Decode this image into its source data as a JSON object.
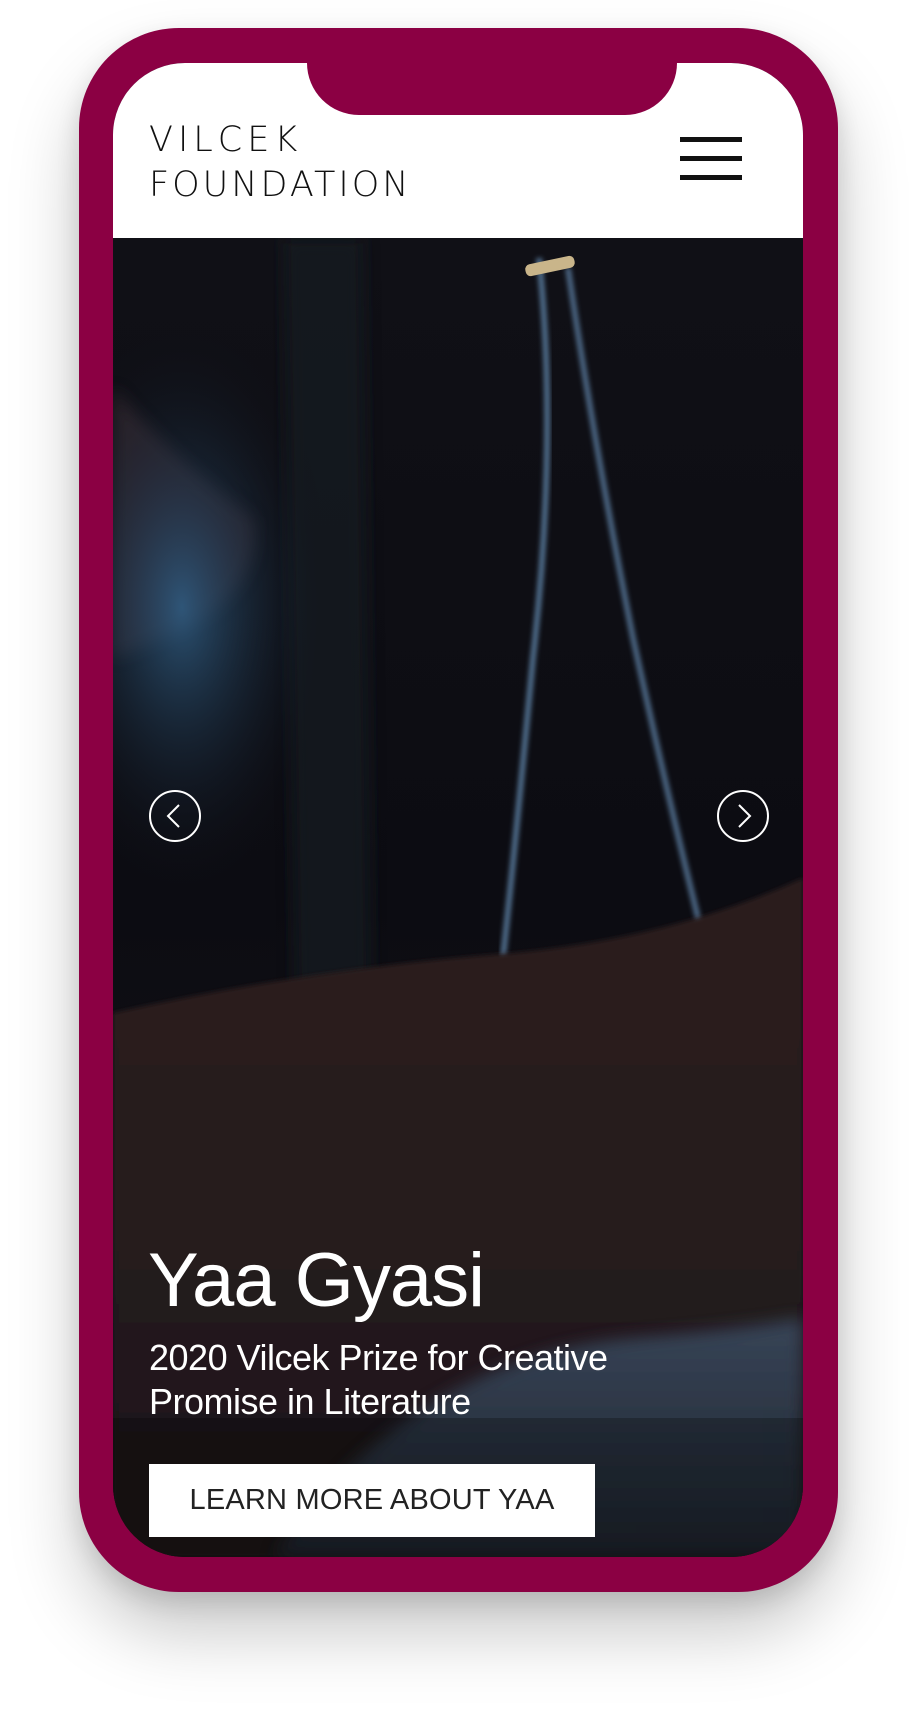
{
  "brand": {
    "logo_line1": "VILCEK",
    "logo_line2": "FOUNDATION",
    "frame_color": "#8b0043"
  },
  "header": {
    "menu_icon": "hamburger-menu-icon"
  },
  "hero": {
    "title": "Yaa Gyasi",
    "subtitle": "2020 Vilcek Prize for Creative Promise in Literature",
    "cta_label": "LEARN MORE ABOUT YAA",
    "prev_icon": "chevron-left-icon",
    "next_icon": "chevron-right-icon"
  }
}
